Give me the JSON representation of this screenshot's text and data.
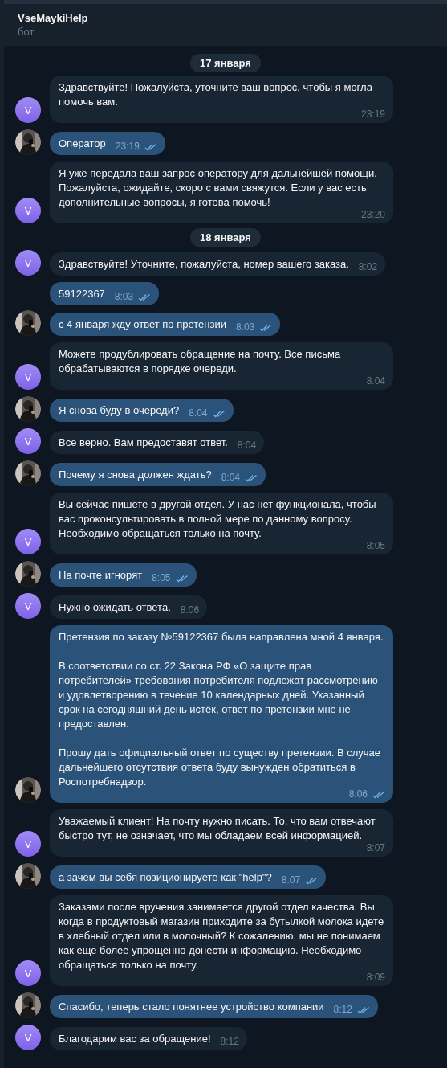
{
  "header": {
    "title": "VseMaykiHelp",
    "subtitle": "бот"
  },
  "feed": [
    {
      "kind": "date",
      "text": "17 января"
    },
    {
      "kind": "message",
      "outgoing": false,
      "avatar": {
        "kind": "letter",
        "letter": "V"
      },
      "text": "Здравствуйте! Пожалуйста, уточните ваш вопрос, чтобы я могла помочь вам.",
      "time": "23:19"
    },
    {
      "kind": "message",
      "outgoing": true,
      "text": "Оператор",
      "time": "23:19",
      "read": true
    },
    {
      "kind": "message",
      "outgoing": false,
      "avatar": {
        "kind": "letter",
        "letter": "V"
      },
      "text": "Я уже передала ваш запрос оператору для дальнейшей помощи. Пожалуйста, ожидайте, скоро с вами свяжутся. Если у вас есть дополнительные вопросы, я готова помочь!",
      "time": "23:20"
    },
    {
      "kind": "date",
      "text": "18 января"
    },
    {
      "kind": "message",
      "outgoing": false,
      "avatar": {
        "kind": "letter",
        "letter": "V"
      },
      "text": "Здравствуйте! Уточните, пожалуйста, номер вашего заказа.",
      "time": "8:02"
    },
    {
      "kind": "message",
      "outgoing": true,
      "text": "59122367",
      "time": "8:03",
      "read": true
    },
    {
      "kind": "message",
      "outgoing": true,
      "text": "с 4 января жду ответ по претензии",
      "time": "8:03",
      "read": true
    },
    {
      "kind": "message",
      "outgoing": false,
      "avatar": {
        "kind": "letter",
        "letter": "V"
      },
      "text": "Можете продублировать обращение на почту. Все письма обрабатываются в порядке очереди.",
      "time": "8:04"
    },
    {
      "kind": "message",
      "outgoing": true,
      "text": "Я снова буду в очереди?",
      "time": "8:04",
      "read": true
    },
    {
      "kind": "message",
      "outgoing": false,
      "avatar": {
        "kind": "letter",
        "letter": "V"
      },
      "text": "Все верно. Вам предоставят ответ.",
      "time": "8:04"
    },
    {
      "kind": "message",
      "outgoing": true,
      "text": "Почему я снова должен ждать?",
      "time": "8:04",
      "read": true
    },
    {
      "kind": "message",
      "outgoing": false,
      "avatar": {
        "kind": "letter",
        "letter": "V"
      },
      "text": "Вы сейчас пишете в другой отдел. У нас нет функционала, чтобы вас проконсультировать в полной мере по данному вопросу. Необходимо обращаться только на почту.",
      "time": "8:05"
    },
    {
      "kind": "message",
      "outgoing": true,
      "text": "На почте игнорят",
      "time": "8:05",
      "read": true
    },
    {
      "kind": "message",
      "outgoing": false,
      "avatar": {
        "kind": "letter",
        "letter": "V"
      },
      "text": "Нужно ожидать ответа.",
      "time": "8:06"
    },
    {
      "kind": "message",
      "outgoing": true,
      "text": "Претензия по заказу №59122367 была направлена мной 4 января.\n\nВ соответствии со ст. 22 Закона РФ «О защите прав потребителей» требования потребителя подлежат рассмотрению и удовлетворению в течение 10 календарных дней. Указанный срок на сегодняшний день истёк, ответ по претензии мне не предоставлен.\n\nПрошу дать официальный ответ по существу претензии. В случае дальнейшего отсутствия ответа буду вынужден обратиться в Роспотребнадзор.",
      "time": "8:06",
      "read": true
    },
    {
      "kind": "message",
      "outgoing": false,
      "avatar": {
        "kind": "letter",
        "letter": "V"
      },
      "text": "Уважаемый клиент! На почту нужно писать. То, что вам отвечают быстро тут, не означает, что мы обладаем всей информацией.",
      "time": "8:07"
    },
    {
      "kind": "message",
      "outgoing": true,
      "text": "а зачем вы себя позиционируете как \"help\"?",
      "time": "8:07",
      "read": true
    },
    {
      "kind": "message",
      "outgoing": false,
      "avatar": {
        "kind": "letter",
        "letter": "V"
      },
      "text": "Заказами после вручения занимается другой отдел качества. Вы когда в продуктовый магазин приходите за бутылкой молока идете в хлебный отдел или в молочный? К сожалению, мы не понимаем как еще более упрощенно донести информацию. Необходимо обращаться только на почту.",
      "time": "8:09"
    },
    {
      "kind": "message",
      "outgoing": true,
      "text": "Спасибо, теперь стало понятнее устройство компании",
      "time": "8:12",
      "read": true
    },
    {
      "kind": "message",
      "outgoing": false,
      "avatar": {
        "kind": "letter",
        "letter": "V"
      },
      "text": "Благодарим вас за обращение!",
      "time": "8:12"
    }
  ]
}
